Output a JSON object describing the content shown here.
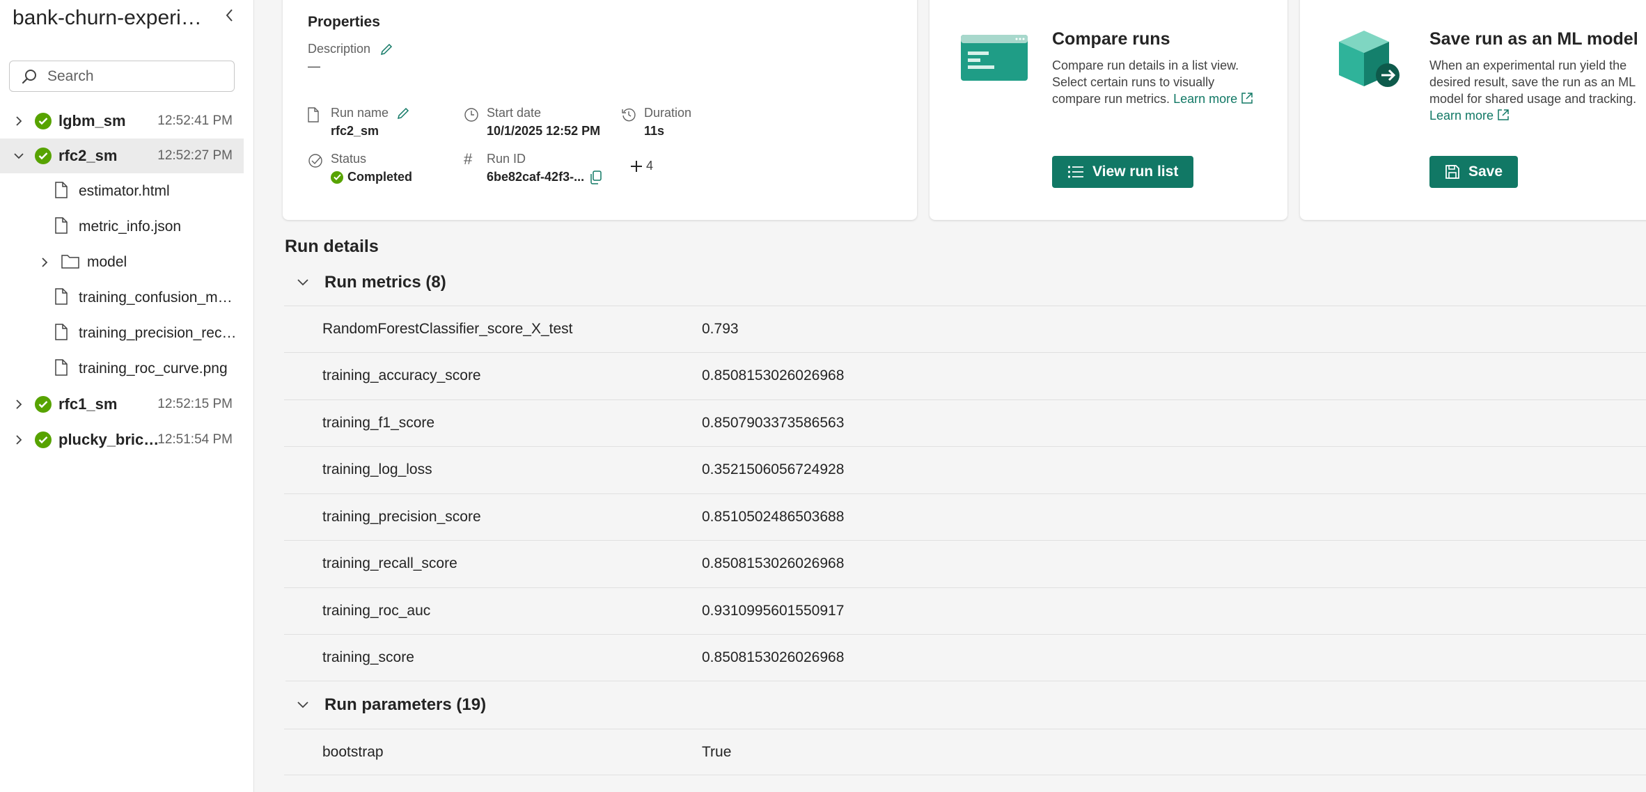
{
  "sidebar": {
    "title": "bank-churn-experiment",
    "search_placeholder": "Search",
    "runs": [
      {
        "name": "lgbm_sm",
        "time": "12:52:41 PM",
        "expanded": false
      },
      {
        "name": "rfc2_sm",
        "time": "12:52:27 PM",
        "expanded": true
      },
      {
        "name": "rfc1_sm",
        "time": "12:52:15 PM",
        "expanded": false
      },
      {
        "name": "plucky_brick_...",
        "time": "12:51:54 PM",
        "expanded": false
      }
    ],
    "files": [
      {
        "name": "estimator.html"
      },
      {
        "name": "metric_info.json"
      },
      {
        "name": "model"
      },
      {
        "name": "training_confusion_mat..."
      },
      {
        "name": "training_precision_recal..."
      },
      {
        "name": "training_roc_curve.png"
      }
    ]
  },
  "properties": {
    "title": "Properties",
    "description_label": "Description",
    "description_value": "—",
    "run_name_label": "Run name",
    "run_name_value": "rfc2_sm",
    "start_date_label": "Start date",
    "start_date_value": "10/1/2025 12:52 PM",
    "duration_label": "Duration",
    "duration_value": "11s",
    "status_label": "Status",
    "status_value": "Completed",
    "run_id_label": "Run ID",
    "run_id_value": "6be82caf-42f3-...",
    "more_count": "4"
  },
  "compare": {
    "title": "Compare runs",
    "desc": "Compare run details in a list view. Select certain runs to visually compare run metrics.",
    "learn_more": "Learn more",
    "button": "View run list"
  },
  "save": {
    "title": "Save run as an ML model",
    "desc": "When an experimental run yield the desired result, save the run as an ML model for shared usage and tracking.",
    "learn_more": "Learn more",
    "button": "Save"
  },
  "run_details": {
    "title": "Run details",
    "metrics_header": "Run metrics (8)",
    "metrics": [
      {
        "key": "RandomForestClassifier_score_X_test",
        "value": "0.793"
      },
      {
        "key": "training_accuracy_score",
        "value": "0.8508153026026968"
      },
      {
        "key": "training_f1_score",
        "value": "0.8507903373586563"
      },
      {
        "key": "training_log_loss",
        "value": "0.3521506056724928"
      },
      {
        "key": "training_precision_score",
        "value": "0.8510502486503688"
      },
      {
        "key": "training_recall_score",
        "value": "0.8508153026026968"
      },
      {
        "key": "training_roc_auc",
        "value": "0.9310995601550917"
      },
      {
        "key": "training_score",
        "value": "0.8508153026026968"
      }
    ],
    "params_header": "Run parameters (19)",
    "params": [
      {
        "key": "bootstrap",
        "value": "True"
      }
    ]
  },
  "colors": {
    "accent": "#117865",
    "success": "#57a300"
  }
}
